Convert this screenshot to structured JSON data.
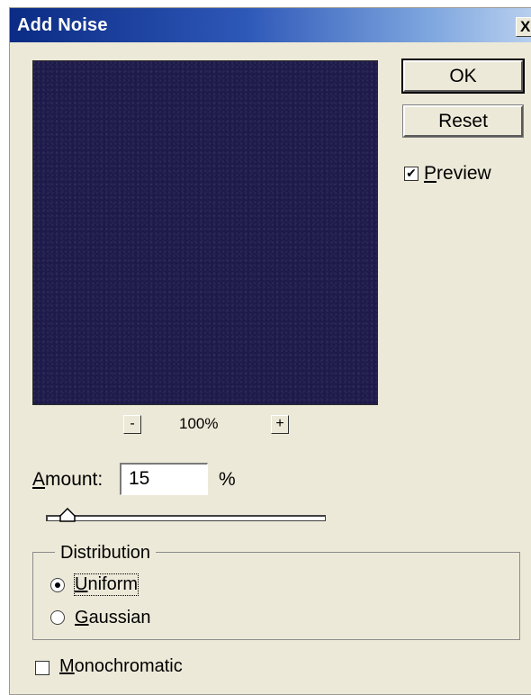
{
  "dialog": {
    "title": "Add Noise",
    "close_glyph": "X"
  },
  "preview": {
    "zoom_out_label": "-",
    "zoom_in_label": "+",
    "zoom_level": "100%"
  },
  "buttons": {
    "ok_label": "OK",
    "reset_label": "Reset"
  },
  "preview_toggle": {
    "label": "Preview",
    "checked": true,
    "check_glyph": "✔"
  },
  "amount": {
    "label": "Amount:",
    "value": "15",
    "unit": "%",
    "slider_fraction": 0.0375
  },
  "distribution": {
    "group_label": "Distribution",
    "options": [
      {
        "label": "Uniform",
        "selected": true
      },
      {
        "label": "Gaussian",
        "selected": false
      }
    ]
  },
  "monochromatic": {
    "label": "Monochromatic",
    "checked": false
  },
  "colors": {
    "titlebar_start": "#0b2b84",
    "dialog_bg": "#ece9d8",
    "preview_bg": "#1d1848"
  },
  "icons": {
    "close": "close-icon",
    "check": "checkmark-icon",
    "radio_dot": "radio-dot-icon",
    "slider_thumb": "slider-thumb-icon"
  }
}
